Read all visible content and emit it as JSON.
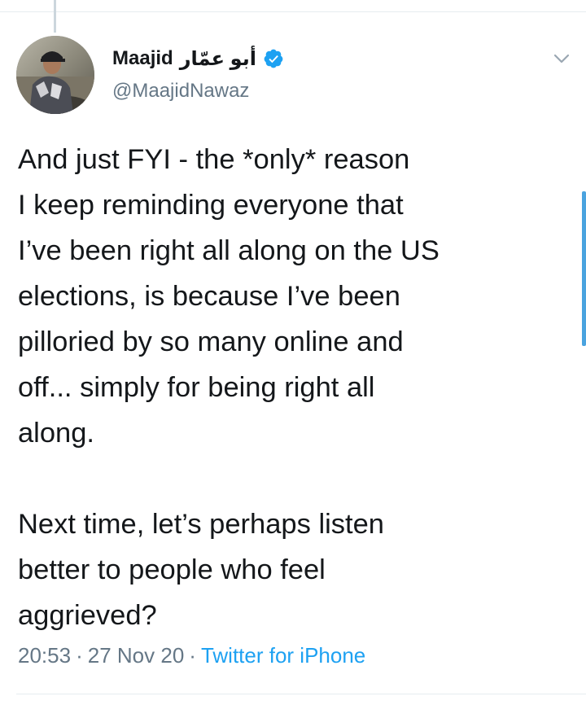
{
  "author": {
    "display_name": "Maajid",
    "display_name_ar": "أبو عمّار",
    "handle": "@MaajidNawaz",
    "verified": true,
    "verified_icon": "verified-badge-icon",
    "avatar_icon": "profile-photo"
  },
  "tweet": {
    "text": "And just FYI - the *only* reason\nI keep reminding everyone that\nI’ve been right all along on the US\nelections, is because I’ve been\npilloried by so many online and\noff... simply for being right all\nalong.\n\nNext time, let’s perhaps listen\nbetter to people who feel\naggrieved?",
    "time": "20:53",
    "date": "27 Nov 20",
    "separator": "·",
    "source": "Twitter for iPhone"
  },
  "menu": {
    "icon": "chevron-down-icon"
  },
  "colors": {
    "text": "#14171a",
    "secondary": "#657786",
    "link": "#1da1f2",
    "divider": "#e6ecf0",
    "scroll_indicator": "#4aa3df"
  }
}
